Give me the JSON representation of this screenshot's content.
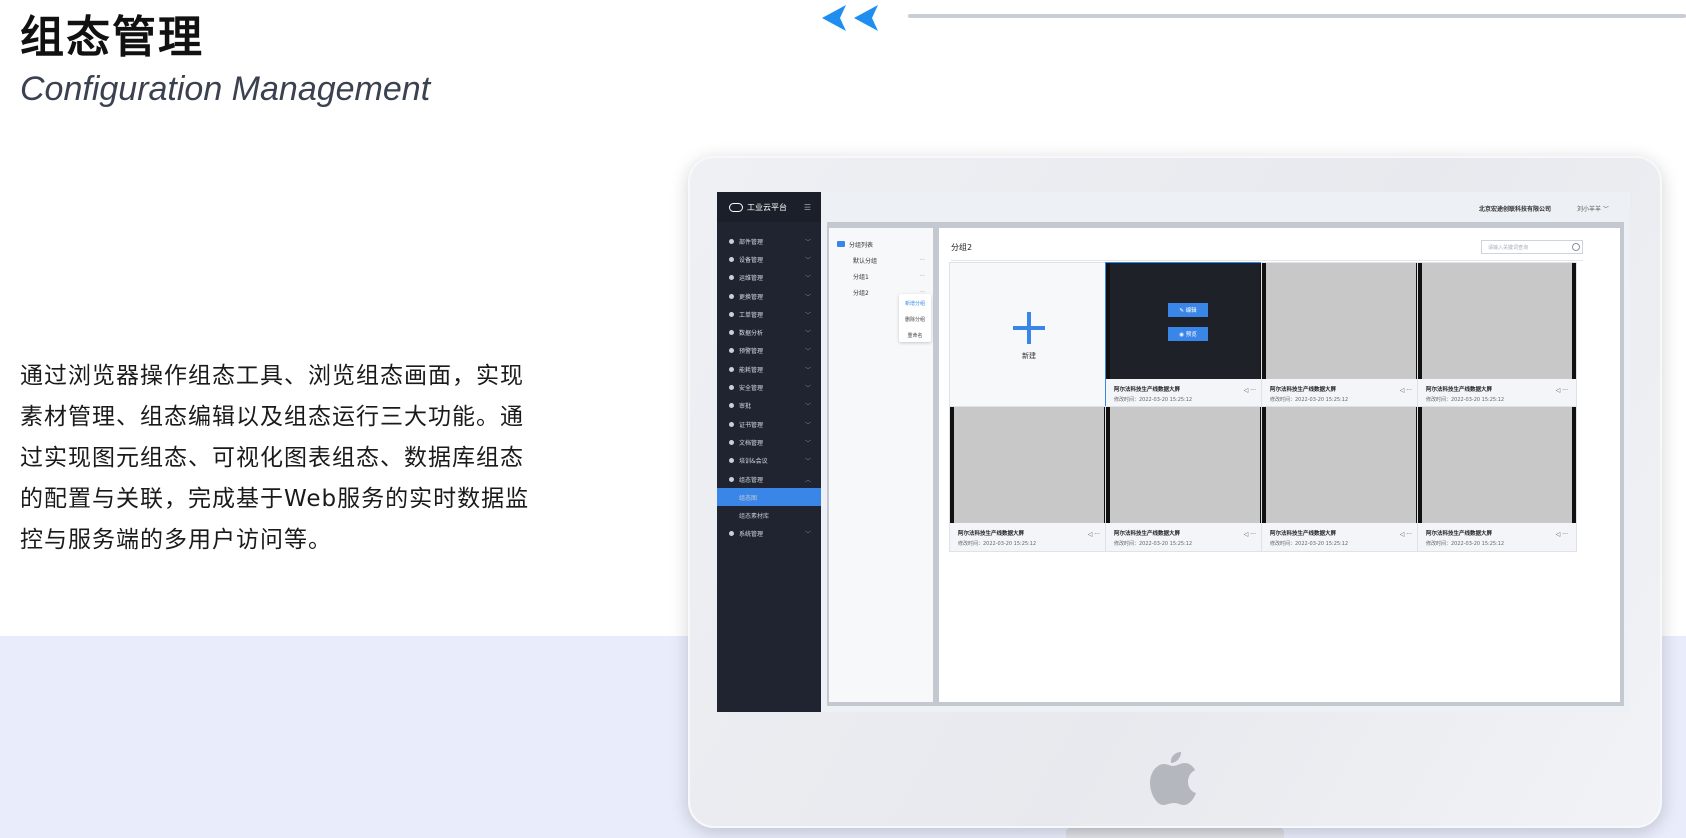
{
  "header": {
    "title_cn": "组态管理",
    "title_en": "Configuration Management"
  },
  "description": {
    "lines": [
      "通过浏览器操作组态工具、浏览组态画面，实现",
      "素材管理、组态编辑以及组态运行三大功能。通",
      "过实现图元组态、可视化图表组态、数据库组态",
      "的配置与关联，完成基于Web服务的实时数据监",
      "控与服务端的多用户访问等。"
    ]
  },
  "colors": {
    "accent": "#3a86e8",
    "sidebar_bg": "#1f2430",
    "band_bg": "#e8ecfb",
    "chevron": "#1e8ff0"
  },
  "app": {
    "brand": "工业云平台",
    "company": "北京宏途创联科技有限公司",
    "user": "刘小羊羊 ﹀",
    "nav": [
      {
        "label": "部件管理",
        "chev": "﹀"
      },
      {
        "label": "设备管理",
        "chev": "﹀"
      },
      {
        "label": "运维管理",
        "chev": "﹀"
      },
      {
        "label": "更换管理",
        "chev": "﹀"
      },
      {
        "label": "工单管理",
        "chev": "﹀"
      },
      {
        "label": "数据分析",
        "chev": "﹀"
      },
      {
        "label": "预警管理",
        "chev": "﹀"
      },
      {
        "label": "能耗管理",
        "chev": "﹀"
      },
      {
        "label": "安全管理",
        "chev": "﹀"
      },
      {
        "label": "审批",
        "chev": "﹀"
      },
      {
        "label": "证书管理",
        "chev": "﹀"
      },
      {
        "label": "文档管理",
        "chev": "﹀"
      },
      {
        "label": "培训&会议",
        "chev": "﹀"
      },
      {
        "label": "组态管理",
        "chev": "︿"
      }
    ],
    "nav_sub": [
      {
        "label": "组态图",
        "active": true
      },
      {
        "label": "组态素材库",
        "active": false
      }
    ],
    "nav_last": {
      "label": "系统管理",
      "chev": "﹀"
    },
    "groups": {
      "root": "分组列表",
      "items": [
        "默认分组",
        "分组1",
        "分组2"
      ],
      "more": "···",
      "context_menu": [
        "新增分组",
        "删除分组",
        "重命名"
      ]
    },
    "main": {
      "title": "分组2",
      "search_placeholder": "请输入关键词查询",
      "new_label": "新建",
      "edit_label": "✎ 编辑",
      "preview_label": "◉ 预览",
      "card_name": "阿尔法科技生产线数据大屏",
      "card_time": "修改时间：2022-03-20 15:25:12",
      "card_actions": "◁ ···"
    }
  }
}
